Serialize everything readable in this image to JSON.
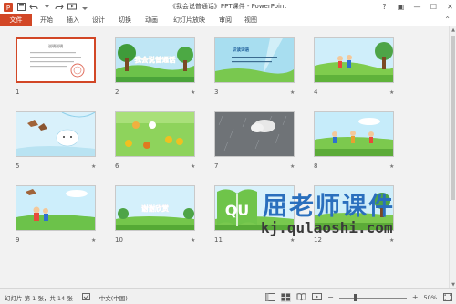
{
  "window": {
    "title": "《我会说普通话》PPT课件 - PowerPoint"
  },
  "quick_access": {
    "icons": [
      "powerpoint-logo-icon",
      "save-icon",
      "undo-icon",
      "redo-icon",
      "present-from-start-icon",
      "customize-dropdown-icon"
    ]
  },
  "window_controls": {
    "help": "?",
    "ribbon_display": "▣",
    "minimize": "—",
    "maximize": "☐",
    "close": "✕"
  },
  "ribbon": {
    "tabs": [
      {
        "label": "文件",
        "active": true
      },
      {
        "label": "开始"
      },
      {
        "label": "插入"
      },
      {
        "label": "设计"
      },
      {
        "label": "切换"
      },
      {
        "label": "动画"
      },
      {
        "label": "幻灯片放映"
      },
      {
        "label": "审阅"
      },
      {
        "label": "视图"
      }
    ],
    "collapse": "⌃"
  },
  "slides": [
    {
      "number": "1",
      "selected": true,
      "has_transition": false,
      "title": "说明说明"
    },
    {
      "number": "2",
      "has_transition": true,
      "title": "我会说普通话"
    },
    {
      "number": "3",
      "has_transition": true,
      "title": "识读词语"
    },
    {
      "number": "4",
      "has_transition": true
    },
    {
      "number": "5",
      "has_transition": true
    },
    {
      "number": "6",
      "has_transition": true
    },
    {
      "number": "7",
      "has_transition": true
    },
    {
      "number": "8",
      "has_transition": true
    },
    {
      "number": "9",
      "has_transition": true
    },
    {
      "number": "10",
      "has_transition": true,
      "title": "谢谢欣赏"
    },
    {
      "number": "11",
      "has_transition": true
    },
    {
      "number": "12",
      "has_transition": true
    }
  ],
  "transition_marker": "★",
  "watermark": {
    "title": "屈老师课件",
    "url": "kj.qulaoshi.com",
    "logo_text": "QU"
  },
  "status": {
    "slide_info": "幻灯片 第 1 张，共 14 张",
    "language": "中文(中国)",
    "zoom_label": "50%",
    "zoom_percent": 50,
    "zoom_minus": "−",
    "zoom_plus": "+"
  },
  "colors": {
    "accent": "#d24726",
    "watermark_blue": "#2a6fbd"
  }
}
